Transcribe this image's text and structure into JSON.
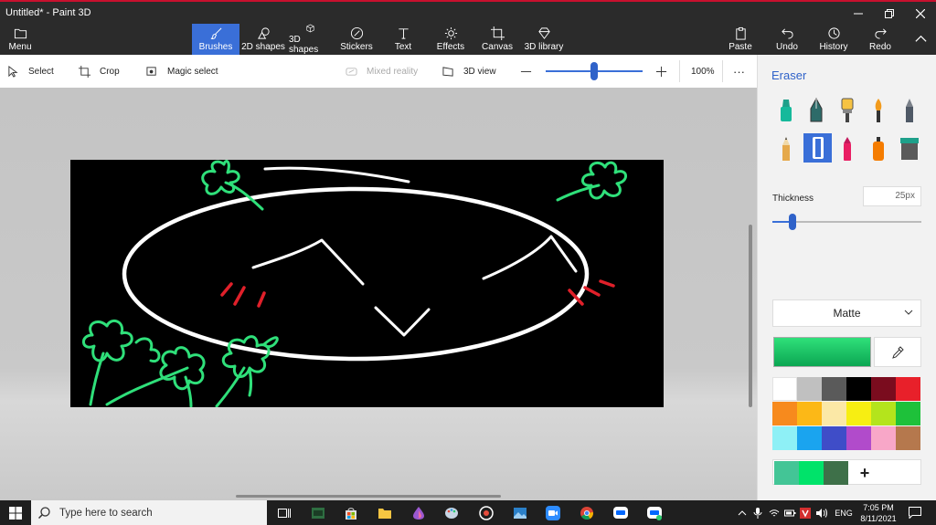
{
  "window": {
    "title": "Untitled* - Paint 3D"
  },
  "ribbon": {
    "menu": "Menu",
    "tabs": [
      "Brushes",
      "2D shapes",
      "3D shapes",
      "Stickers",
      "Text",
      "Effects",
      "Canvas",
      "3D library"
    ],
    "active_tab": "Brushes",
    "right_buttons": [
      "Paste",
      "Undo",
      "History",
      "Redo"
    ]
  },
  "toolbar": {
    "select": "Select",
    "crop": "Crop",
    "magic_select": "Magic select",
    "mixed_reality": "Mixed reality",
    "view_3d": "3D view",
    "zoom": "100%",
    "more": "···"
  },
  "panel": {
    "title": "Eraser",
    "thickness_label": "Thickness",
    "thickness_value": "25px",
    "finish": "Matte",
    "add_color": "+"
  },
  "colors": {
    "accent": "#3a6fd8",
    "clover_green": "#2fe07a",
    "blush_red": "#e0202a",
    "palette": [
      "#ffffff",
      "#c0c0c0",
      "#5a5a5a",
      "#000000",
      "#7a0c1e",
      "#e8202a",
      "#f78a1d",
      "#fcb817",
      "#fbe8a6",
      "#f7ee12",
      "#b4e41c",
      "#1ec13a",
      "#8ef0f6",
      "#1aa4ef",
      "#3f4dc8",
      "#b14bcb",
      "#f8a7c8",
      "#b5784d"
    ],
    "custom": [
      "#43c596",
      "#00e36a",
      "#3e7049"
    ]
  },
  "taskbar": {
    "search_placeholder": "Type here to search",
    "language": "ENG",
    "time": "7:05 PM",
    "date": "8/11/2021"
  }
}
